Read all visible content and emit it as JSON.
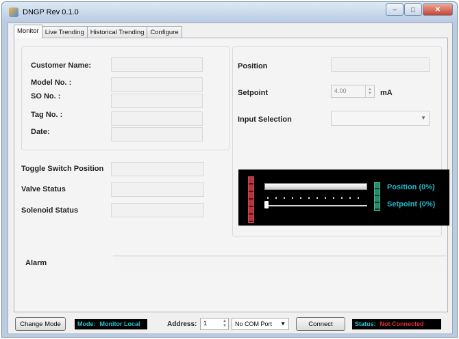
{
  "window": {
    "title": "DNGP Rev 0.1.0",
    "minimize_glyph": "–",
    "maximize_glyph": "□",
    "close_glyph": "✕"
  },
  "tabs": [
    {
      "label": "Monitor",
      "active": true
    },
    {
      "label": "Live Trending",
      "active": false
    },
    {
      "label": "Historical Trending",
      "active": false
    },
    {
      "label": "Configure",
      "active": false
    }
  ],
  "info": {
    "customer_name_label": "Customer Name:",
    "model_no_label": "Model No. :",
    "so_no_label": "SO No. :",
    "tag_no_label": "Tag No. :",
    "date_label": "Date:"
  },
  "status": {
    "toggle_switch_label": "Toggle Switch Position",
    "valve_status_label": "Valve Status",
    "solenoid_status_label": "Solenoid Status"
  },
  "control": {
    "position_label": "Position",
    "setpoint_label": "Setpoint",
    "setpoint_value": "4.00",
    "setpoint_unit": "mA",
    "input_selection_label": "Input Selection",
    "input_selection_value": ""
  },
  "gauge": {
    "position_legend": "Position (0%)",
    "setpoint_legend": "Setpoint (0%)",
    "position_percent": 0,
    "setpoint_percent": 0,
    "accent_color": "#21b7c7"
  },
  "alarm": {
    "label": "Alarm"
  },
  "footer": {
    "change_mode_label": "Change Mode",
    "mode_key": "Mode:",
    "mode_value": "Monitor Local",
    "address_label": "Address:",
    "address_value": "1",
    "com_port_value": "No COM Port",
    "connect_label": "Connect",
    "status_key": "Status:",
    "status_value": "Not Connected",
    "status_color": "#e03040"
  }
}
